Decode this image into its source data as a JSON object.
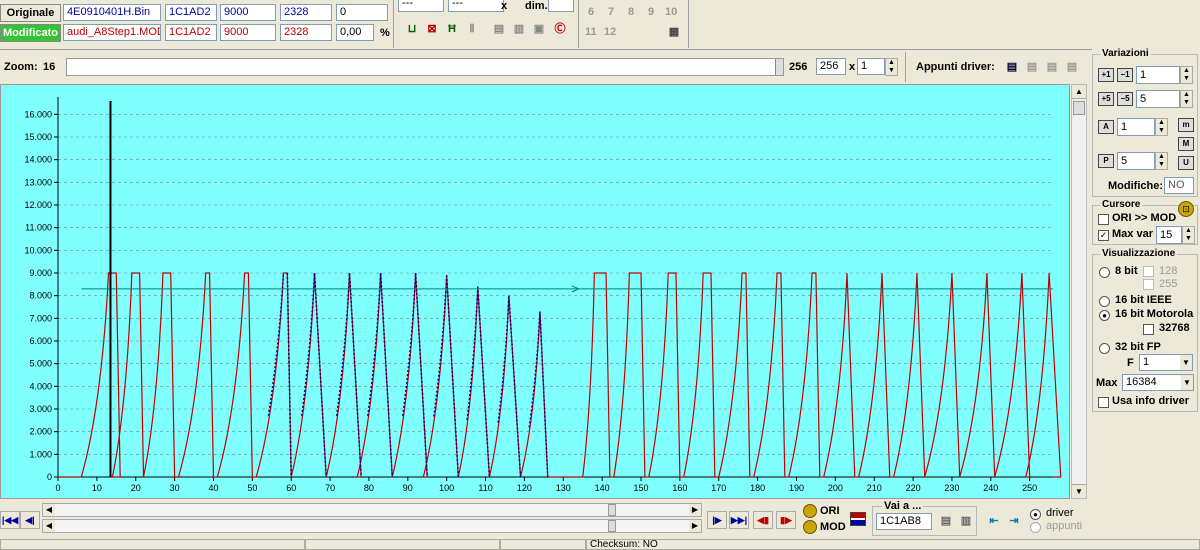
{
  "files": {
    "orig_label": "Originale",
    "mod_label": "Modificato",
    "orig": {
      "name": "4E0910401H.Bin",
      "checksum": "1C1AD2",
      "val1": "9000",
      "val2": "2328",
      "val3": "0"
    },
    "mod": {
      "name": "audi_A8Step1.MOD",
      "checksum": "1C1AD2",
      "val1": "9000",
      "val2": "2328",
      "val3": "0,00",
      "pct": "%"
    }
  },
  "toolbar": {
    "hex1": "---",
    "hex2": "---",
    "x_label": "x",
    "dim_label": "dim.",
    "pages": [
      "6",
      "7",
      "8",
      "9",
      "10",
      "11",
      "12"
    ]
  },
  "zoom": {
    "label": "Zoom:",
    "min": "16",
    "max": "256",
    "value": "256",
    "x_label": "x",
    "multiplier": "1",
    "driver_label": "Appunti driver:"
  },
  "variazioni": {
    "title": "Variazioni",
    "spin1": "1",
    "spin2": "5",
    "spin3": "1",
    "spin4": "5",
    "modifiche_label": "Modifiche:",
    "modifiche_value": "NO"
  },
  "cursore": {
    "title": "Cursore",
    "ori_mod_label": "ORI >> MOD",
    "ori_mod_checked": false,
    "maxvar_label": "Max var",
    "maxvar_checked": true,
    "maxvar_value": "15"
  },
  "visualizzazione": {
    "title": "Visualizzazione",
    "bit8": "8 bit",
    "opt128": "128",
    "opt255": "255",
    "bit16ieee": "16 bit IEEE",
    "bit16moto": "16 bit Motorola",
    "opt32768": "32768",
    "bit32fp": "32 bit FP",
    "f_label": "F",
    "f_value": "1",
    "max_label": "Max",
    "max_value": "16384",
    "usa_info": "Usa info driver",
    "selected": "16 bit Motorola"
  },
  "navigation": {
    "vai_label": "Vai a ...",
    "vai_value": "1C1AB8",
    "ori_btn": "ORI",
    "mod_btn": "MOD",
    "driver_label": "driver",
    "appunti_label": "appunti"
  },
  "status": {
    "checksum": "Checksum: NO"
  },
  "chart_data": {
    "type": "line",
    "x_ticks": [
      0,
      10,
      20,
      30,
      40,
      50,
      60,
      70,
      80,
      90,
      100,
      110,
      120,
      130,
      140,
      150,
      160,
      170,
      180,
      190,
      200,
      210,
      220,
      230,
      240,
      250
    ],
    "y_ticks": [
      "0",
      "1.000",
      "2.000",
      "3.000",
      "4.000",
      "5.000",
      "6.000",
      "7.000",
      "8.000",
      "9.000",
      "10.000",
      "11.000",
      "12.000",
      "13.000",
      "14.000",
      "15.000",
      "16.000"
    ],
    "xlim": [
      0,
      256
    ],
    "ylim": [
      0,
      16500
    ],
    "cursor_x": 13.5,
    "reference_y": 8300,
    "grid": true,
    "colors": {
      "background": "#80ffff",
      "original": "#c00000",
      "modified": "#0000a0",
      "reference": "#008080"
    },
    "series": [
      {
        "peaks": [
          {
            "start": 6,
            "rise": 7,
            "peak": 9000,
            "hold": 2,
            "fall": 1
          },
          {
            "start": 14,
            "rise": 5,
            "peak": 9000,
            "hold": 2,
            "fall": 1
          },
          {
            "start": 22,
            "rise": 5,
            "peak": 9000,
            "hold": 2,
            "fall": 1
          },
          {
            "start": 31,
            "rise": 7,
            "peak": 9000,
            "hold": 1,
            "fall": 1
          },
          {
            "start": 41,
            "rise": 7,
            "peak": 9000,
            "hold": 1,
            "fall": 1
          },
          {
            "start": 51,
            "rise": 7,
            "peak": 9000,
            "hold": 1,
            "fall": 1
          },
          {
            "start": 60,
            "rise": 6,
            "peak": 9000,
            "hold": 0,
            "fall": 3
          },
          {
            "start": 69,
            "rise": 6,
            "peak": 9000,
            "hold": 0,
            "fall": 3
          },
          {
            "start": 77,
            "rise": 6,
            "peak": 9000,
            "hold": 0,
            "fall": 3
          },
          {
            "start": 86,
            "rise": 6,
            "peak": 9000,
            "hold": 0,
            "fall": 3
          },
          {
            "start": 94,
            "rise": 6,
            "peak": 8900,
            "hold": 0,
            "fall": 3
          },
          {
            "start": 103,
            "rise": 5,
            "peak": 8400,
            "hold": 0,
            "fall": 3
          },
          {
            "start": 111,
            "rise": 5,
            "peak": 8000,
            "hold": 0,
            "fall": 3
          },
          {
            "start": 119,
            "rise": 5,
            "peak": 7300,
            "hold": 0,
            "fall": 2
          },
          {
            "start": 135,
            "rise": 3,
            "peak": 9000,
            "hold": 3,
            "fall": 1
          },
          {
            "start": 143,
            "rise": 4,
            "peak": 9000,
            "hold": 3,
            "fall": 1
          },
          {
            "start": 152,
            "rise": 5,
            "peak": 9000,
            "hold": 2,
            "fall": 1
          },
          {
            "start": 161,
            "rise": 5,
            "peak": 9000,
            "hold": 2,
            "fall": 1
          },
          {
            "start": 170,
            "rise": 6,
            "peak": 9000,
            "hold": 1,
            "fall": 1
          },
          {
            "start": 179,
            "rise": 6,
            "peak": 9000,
            "hold": 1,
            "fall": 1
          },
          {
            "start": 188,
            "rise": 6,
            "peak": 9000,
            "hold": 1,
            "fall": 1
          },
          {
            "start": 197,
            "rise": 6,
            "peak": 9000,
            "hold": 0,
            "fall": 2
          },
          {
            "start": 206,
            "rise": 6,
            "peak": 9000,
            "hold": 0,
            "fall": 2
          },
          {
            "start": 215,
            "rise": 6,
            "peak": 9000,
            "hold": 0,
            "fall": 2
          },
          {
            "start": 223,
            "rise": 7,
            "peak": 9000,
            "hold": 0,
            "fall": 2
          },
          {
            "start": 232,
            "rise": 7,
            "peak": 9000,
            "hold": 0,
            "fall": 2
          },
          {
            "start": 241,
            "rise": 7,
            "peak": 9000,
            "hold": 0,
            "fall": 2
          },
          {
            "start": 249,
            "rise": 6,
            "peak": 9000,
            "hold": 0,
            "fall": 3
          }
        ]
      }
    ]
  }
}
